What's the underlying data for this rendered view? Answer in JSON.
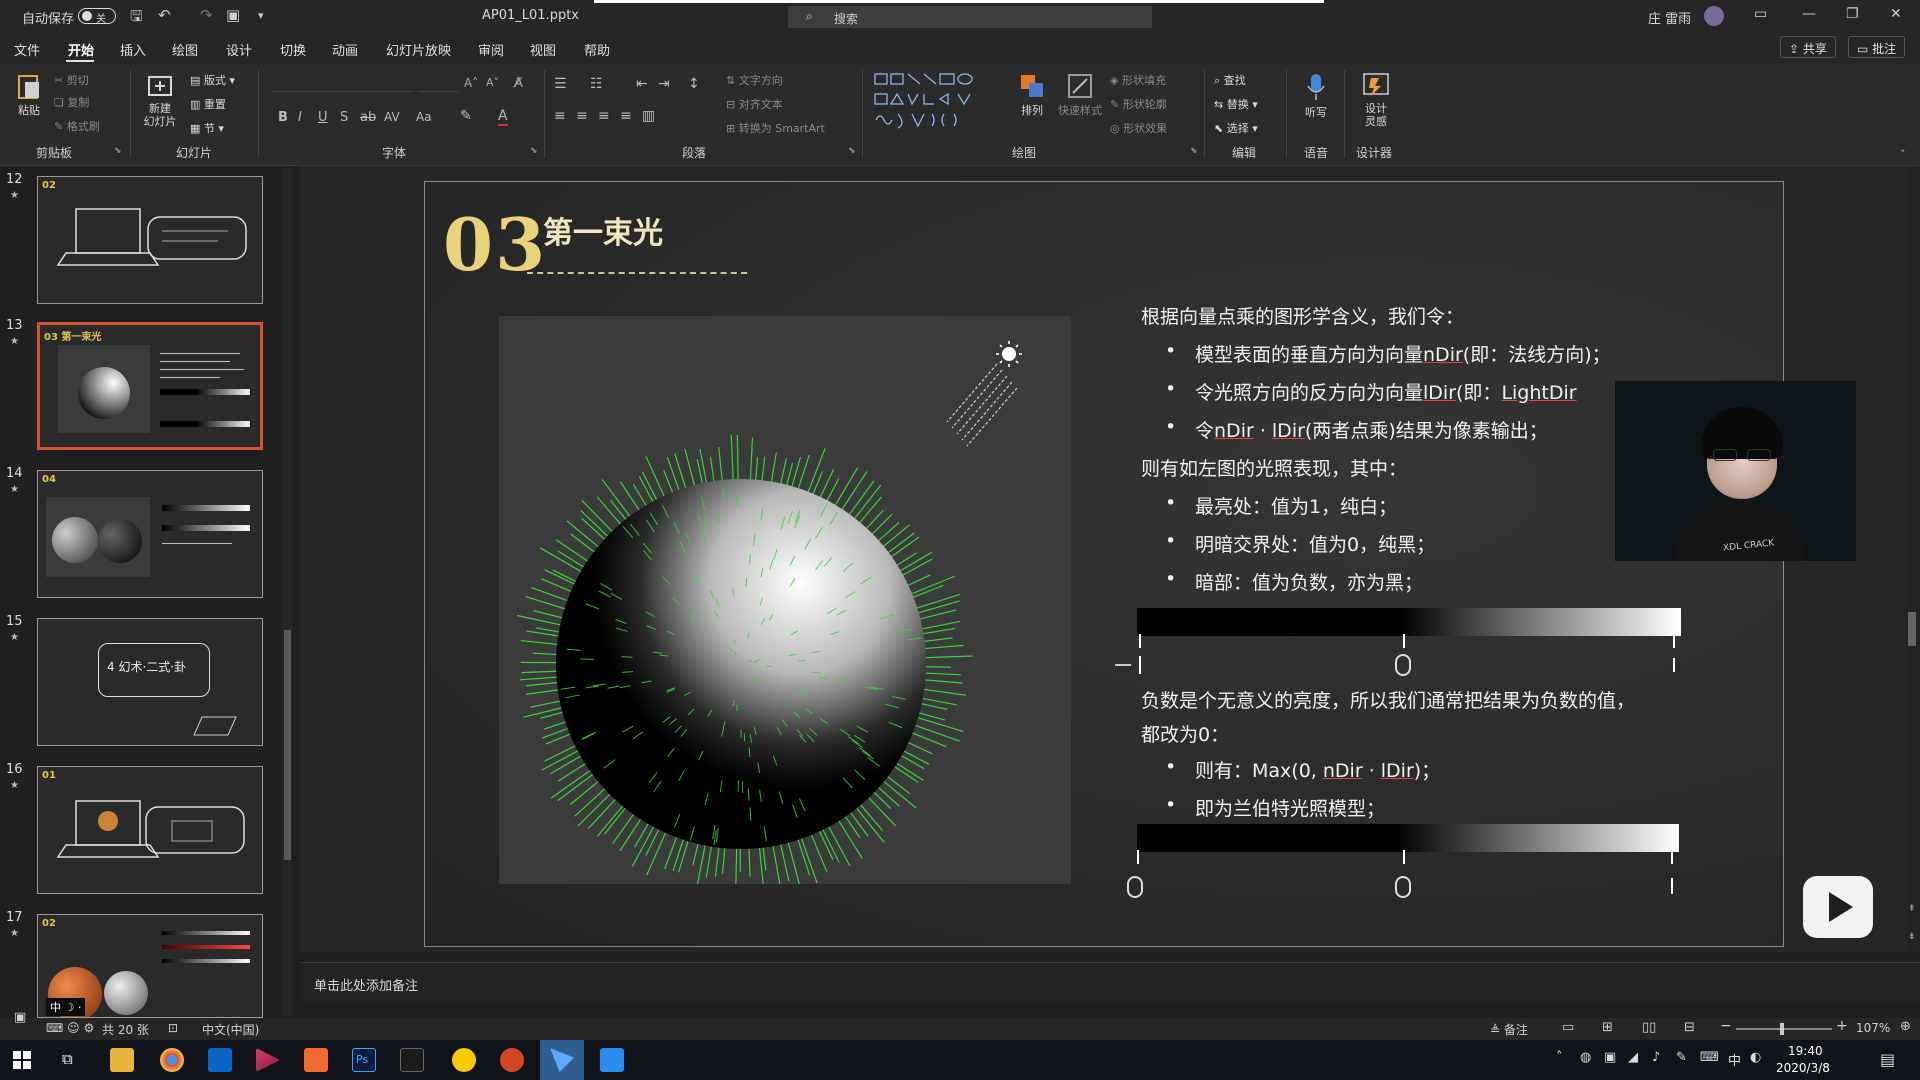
{
  "titlebar": {
    "autosave_label": "自动保存",
    "autosave_state": "关",
    "filename": "AP01_L01.pptx",
    "search_placeholder": "搜索",
    "user_name": "庄 雷雨"
  },
  "menu": {
    "items": [
      "文件",
      "开始",
      "插入",
      "绘图",
      "设计",
      "切换",
      "动画",
      "幻灯片放映",
      "审阅",
      "视图",
      "帮助"
    ],
    "active": "开始",
    "share": "共享",
    "comment": "批注"
  },
  "ribbon": {
    "groups": [
      "剪贴板",
      "幻灯片",
      "字体",
      "段落",
      "绘图",
      "编辑",
      "语音",
      "设计器"
    ],
    "clipboard": {
      "paste": "粘贴",
      "cut": "剪切",
      "copy": "复制",
      "format_painter": "格式刷"
    },
    "slides": {
      "new_slide": "新建\n幻灯片",
      "layout": "版式",
      "reset": "重置",
      "section": "节"
    },
    "paragraph": {
      "text_direction": "文字方向",
      "align_text": "对齐文本",
      "smartart": "转换为 SmartArt"
    },
    "drawing": {
      "arrange": "排列",
      "quick_styles": "快速样式",
      "fill": "形状填充",
      "outline": "形状轮廓",
      "effects": "形状效果"
    },
    "editing": {
      "find": "查找",
      "replace": "替换",
      "select": "选择"
    },
    "voice": {
      "dictate": "听写"
    },
    "designer": {
      "design_ideas": "设计\n灵感"
    }
  },
  "thumbnails": [
    {
      "num": "12",
      "title": "02"
    },
    {
      "num": "13",
      "title": "03 第一束光",
      "selected": true
    },
    {
      "num": "14",
      "title": "04"
    },
    {
      "num": "15",
      "title": "4 幻术·二式·卦"
    },
    {
      "num": "16",
      "title": "01"
    },
    {
      "num": "17",
      "title": "02"
    }
  ],
  "slide": {
    "number": "03",
    "title": "第一束光",
    "intro": "根据向量点乘的图形学含义，我们令：",
    "b1_pre": "模型表面的垂直方向为向量",
    "b1_var": "nDir",
    "b1_post": "(即：法线方向)；",
    "b2_pre": "令光照方向的反方向为向量",
    "b2_var": "lDir",
    "b2_mid": "(即：",
    "b2_var2": "LightDir",
    "b3_pre": "令",
    "b3_var1": "nDir",
    "b3_dot": " · ",
    "b3_var2": "lDir",
    "b3_post": "(两者点乘)结果为像素输出；",
    "then": "则有如左图的光照表现，其中：",
    "b4": "最亮处：值为1，纯白；",
    "b5": "明暗交界处：值为0，纯黑；",
    "b6": "暗部：值为负数，亦为黑；",
    "negative_line1": "负数是个无意义的亮度，所以我们通常把结果为负数的值，",
    "negative_line2": "都改为0：",
    "b7_pre": "则有：Max(0, ",
    "b7_var1": "nDir",
    "b7_dot": " · ",
    "b7_var2": "lDir",
    "b7_post": ")；",
    "b8": "即为兰伯特光照模型；"
  },
  "webcam": {
    "shirt_text": "XDL CRACK"
  },
  "notes": {
    "placeholder": "单击此处添加备注"
  },
  "statusbar": {
    "slide_count": "共 20 张",
    "language": "中文(中国)",
    "notes_button": "备注",
    "zoom": "107%"
  },
  "taskbar": {
    "time": "19:40",
    "date": "2020/3/8"
  },
  "colors": {
    "accent_selected": "#d35230",
    "slide_number": "#e9d37a",
    "normals": "#3ad23a"
  }
}
